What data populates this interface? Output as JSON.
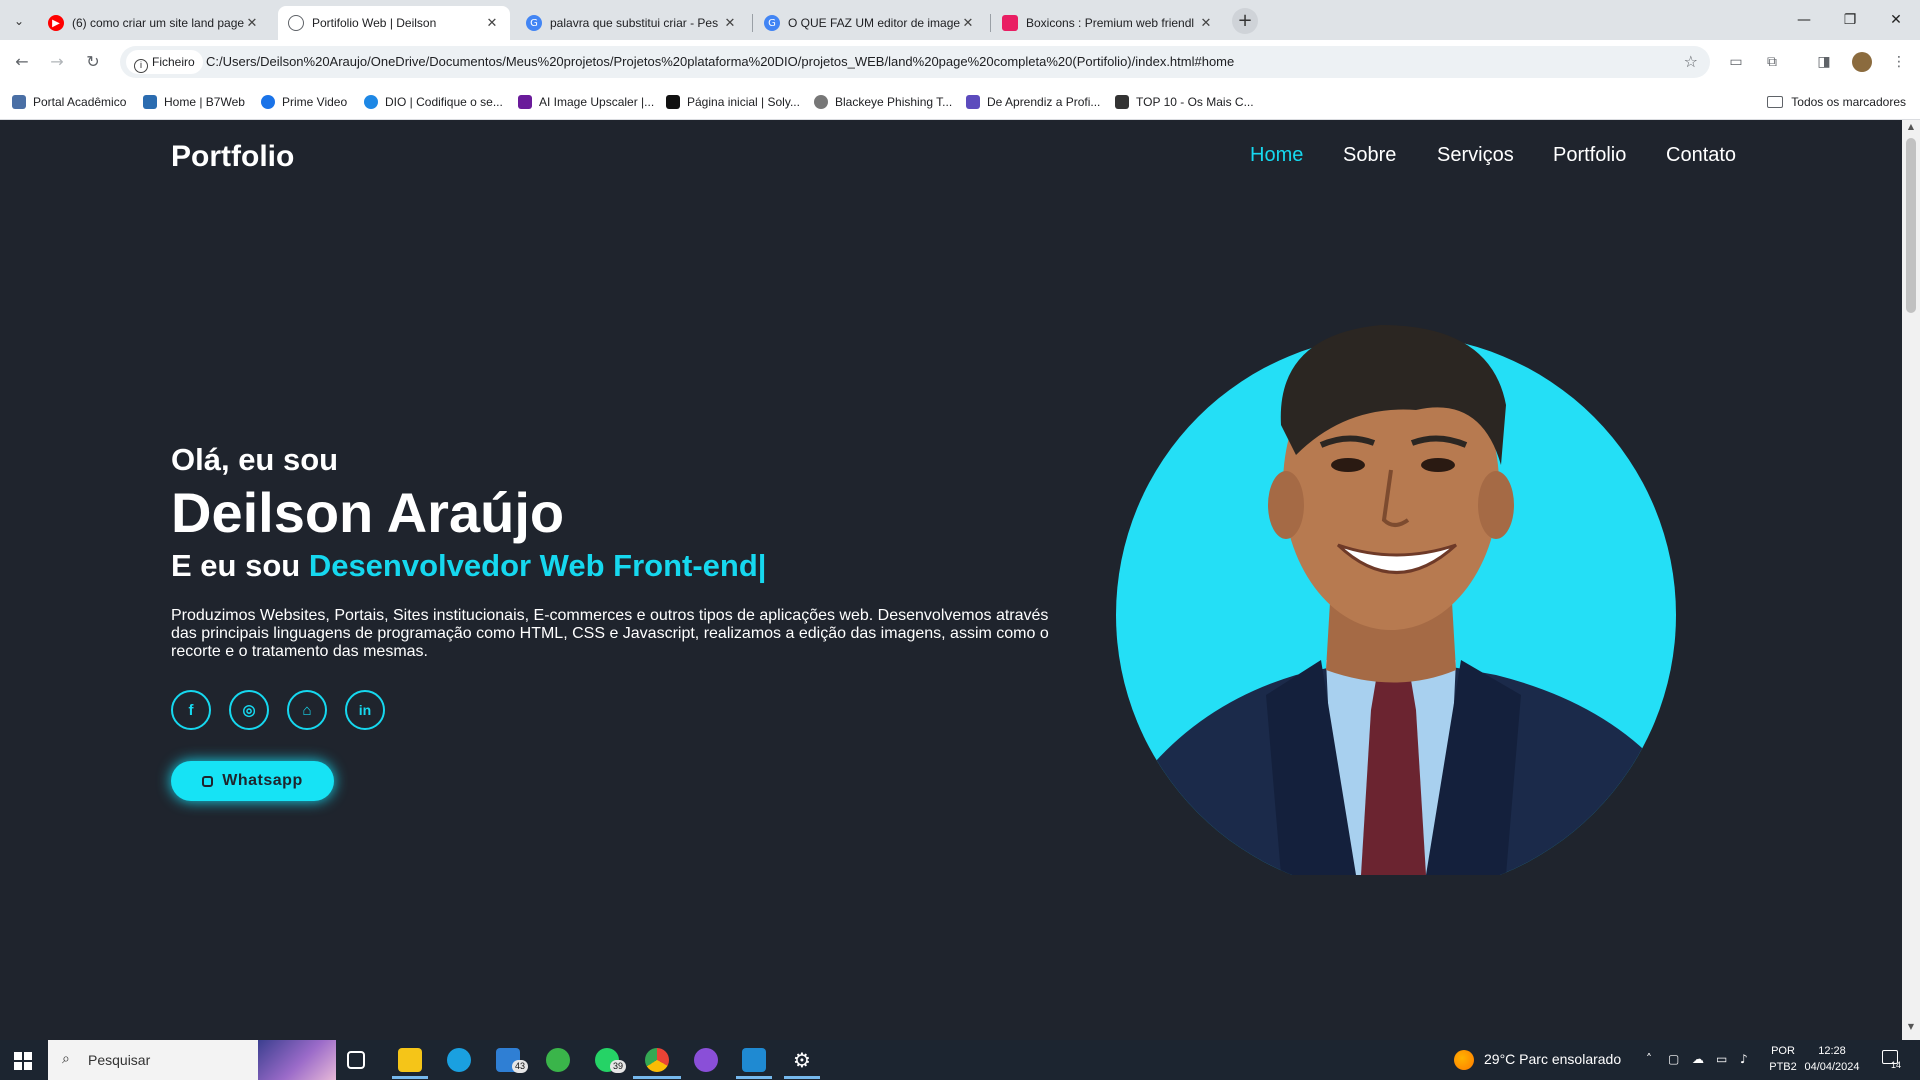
{
  "browser": {
    "tabs": [
      {
        "title": "(6) como criar um site land page",
        "favicon_color": "#ff0000",
        "active": false
      },
      {
        "title": "Portifolio Web | Deilson",
        "favicon_color": "#5f6368",
        "active": true
      },
      {
        "title": "palavra que substitui criar - Pes",
        "favicon_color": "#4285f4",
        "active": false
      },
      {
        "title": "O QUE FAZ UM editor de image",
        "favicon_color": "#4285f4",
        "active": false
      },
      {
        "title": "Boxicons : Premium web friendl",
        "favicon_color": "#e91e63",
        "active": false
      }
    ],
    "address": {
      "chip_label": "Ficheiro",
      "url": "C:/Users/Deilson%20Araujo/OneDrive/Documentos/Meus%20projetos/Projetos%20plataforma%20DIO/projetos_WEB/land%20page%20completa%20(Portifolio)/index.html#home"
    },
    "bookmarks": [
      {
        "label": "Portal Acadêmico",
        "color": "#4a6fa5"
      },
      {
        "label": "Home | B7Web",
        "color": "#2b6cb0"
      },
      {
        "label": "Prime Video",
        "color": "#1a73e8"
      },
      {
        "label": "DIO | Codifique o se...",
        "color": "#1e88e5"
      },
      {
        "label": "AI Image Upscaler |...",
        "color": "#6a1b9a"
      },
      {
        "label": "Página inicial | Soly...",
        "color": "#111111"
      },
      {
        "label": "Blackeye Phishing T...",
        "color": "#777777"
      },
      {
        "label": "De Aprendiz a Profi...",
        "color": "#5c4bbd"
      },
      {
        "label": "TOP 10 - Os Mais C...",
        "color": "#333333"
      }
    ],
    "all_bookmarks_label": "Todos os marcadores"
  },
  "site": {
    "logo": "Portfolio",
    "nav": [
      "Home",
      "Sobre",
      "Serviços",
      "Portfolio",
      "Contato"
    ],
    "active_nav": "Home",
    "accent_color": "#16d8ef",
    "background_color": "#1f242d",
    "hero": {
      "greeting": "Olá, eu sou",
      "name": "Deilson Araújo",
      "role_prefix": "E eu sou ",
      "role_highlight": "Desenvolvedor Web Front-end|",
      "description": "Produzimos Websites, Portais, Sites institucionais, E-commerces e outros tipos de aplicações web. Desenvolvemos através das principais linguagens de programação como HTML, CSS e Javascript, realizamos a edição das imagens, assim como o recorte e o tratamento das mesmas.",
      "social_icons": [
        "facebook-icon",
        "instagram-icon",
        "github-icon",
        "linkedin-icon"
      ],
      "social_glyphs": [
        "f",
        "◎",
        "⌂",
        "in"
      ],
      "whatsapp_label": "Whatsapp"
    }
  },
  "taskbar": {
    "search_placeholder": "Pesquisar",
    "mail_badge": "43",
    "whatsapp_badge": "39",
    "weather": "29°C  Parc ensolarado",
    "lang_line1": "POR",
    "lang_line2": "PTB2",
    "time": "12:28",
    "date": "04/04/2024",
    "notifications": "14"
  }
}
